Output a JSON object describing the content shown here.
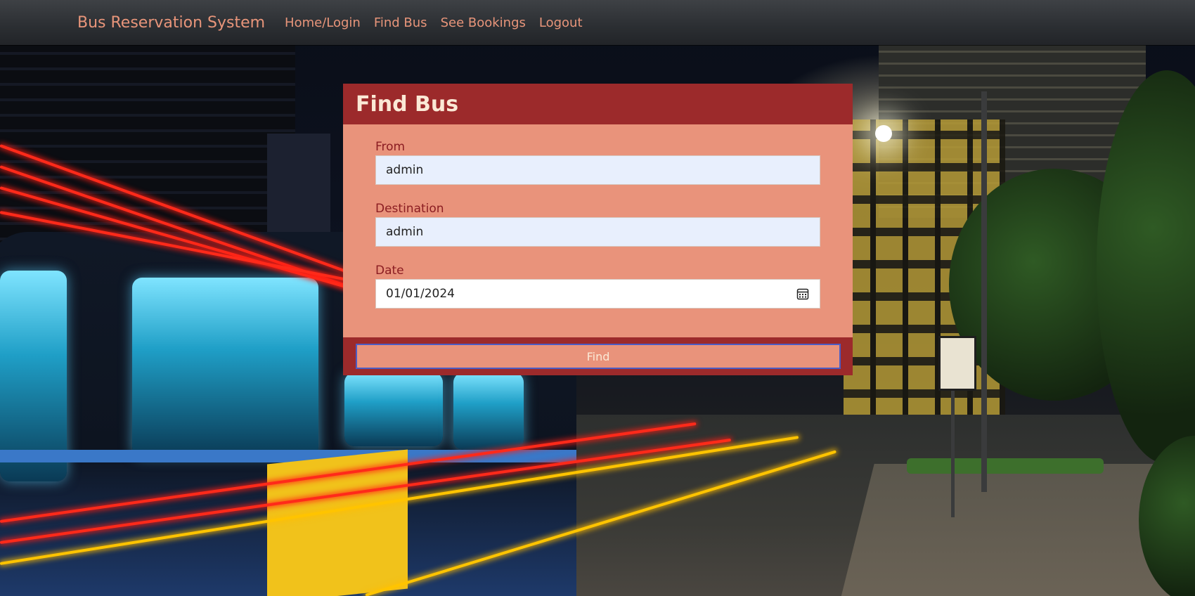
{
  "navbar": {
    "brand": "Bus Reservation System",
    "links": [
      "Home/Login",
      "Find Bus",
      "See Bookings",
      "Logout"
    ],
    "link_color": "#e8957a"
  },
  "form": {
    "title": "Find Bus",
    "from": {
      "label": "From",
      "value": "admin"
    },
    "destination": {
      "label": "Destination",
      "value": "admin"
    },
    "date": {
      "label": "Date",
      "value": "01/01/2024",
      "icon": "calendar-icon"
    },
    "submit_label": "Find"
  },
  "colors": {
    "card_header": "#9c2a2b",
    "card_body": "#e9937b",
    "label": "#8b1d22",
    "input_bg": "#e8effd",
    "button_border": "#4b5cc4"
  },
  "background": {
    "description_icon": "night-street-bus-photo"
  }
}
